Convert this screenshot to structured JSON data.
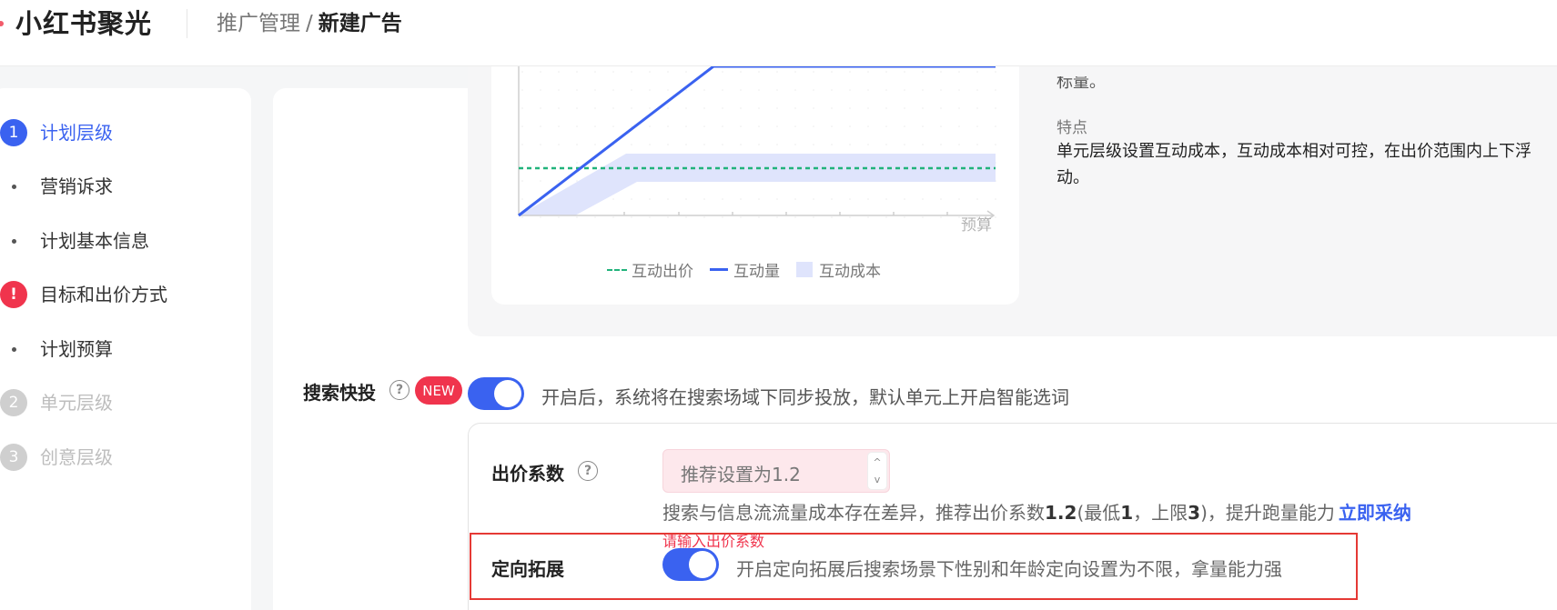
{
  "header": {
    "brand": "小红书聚光",
    "breadcrumb_parent": "推广管理",
    "breadcrumb_separator": "/",
    "breadcrumb_current": "新建广告"
  },
  "sidebar": {
    "steps": [
      {
        "marker": "1",
        "label": "计划层级",
        "state": "active"
      },
      {
        "marker": "•",
        "label": "营销诉求",
        "state": "normal"
      },
      {
        "marker": "•",
        "label": "计划基本信息",
        "state": "normal"
      },
      {
        "marker": "!",
        "label": "目标和出价方式",
        "state": "error"
      },
      {
        "marker": "•",
        "label": "计划预算",
        "state": "normal"
      },
      {
        "marker": "2",
        "label": "单元层级",
        "state": "disabled"
      },
      {
        "marker": "3",
        "label": "创意层级",
        "state": "disabled"
      }
    ]
  },
  "chart_data": {
    "type": "line",
    "xlabel": "预算",
    "legend": [
      "互动出价",
      "互动量",
      "互动成本"
    ],
    "colors": {
      "bid": "#21b37b",
      "volume": "#3a62f0",
      "cost_band": "#dfe4fc"
    }
  },
  "info": {
    "cut_text": "标量。",
    "feature_title": "特点",
    "feature_desc": "单元层级设置互动成本，互动成本相对可控，在出价范围内上下浮动。"
  },
  "search_boost": {
    "label": "搜索快投",
    "help": "?",
    "badge": "NEW",
    "enabled": true,
    "desc": "开启后，系统将在搜索场域下同步投放，默认单元上开启智能选词"
  },
  "bid_coef": {
    "label": "出价系数",
    "help": "?",
    "placeholder": "推荐设置为1.2",
    "stepper_up": "^",
    "stepper_down": "v",
    "hint_prefix": "搜索与信息流流量成本存在差异，推荐出价系数",
    "hint_value": "1.2",
    "hint_min_prefix": "(最低",
    "hint_min": "1",
    "hint_max_prefix": "，上限",
    "hint_max": "3",
    "hint_suffix": ")，提升跑量能力",
    "link": "立即采纳",
    "error": "请输入出价系数"
  },
  "targeting": {
    "label": "定向拓展",
    "enabled": true,
    "desc": "开启定向拓展后搜索场景下性别和年龄定向设置为不限，拿量能力强"
  }
}
